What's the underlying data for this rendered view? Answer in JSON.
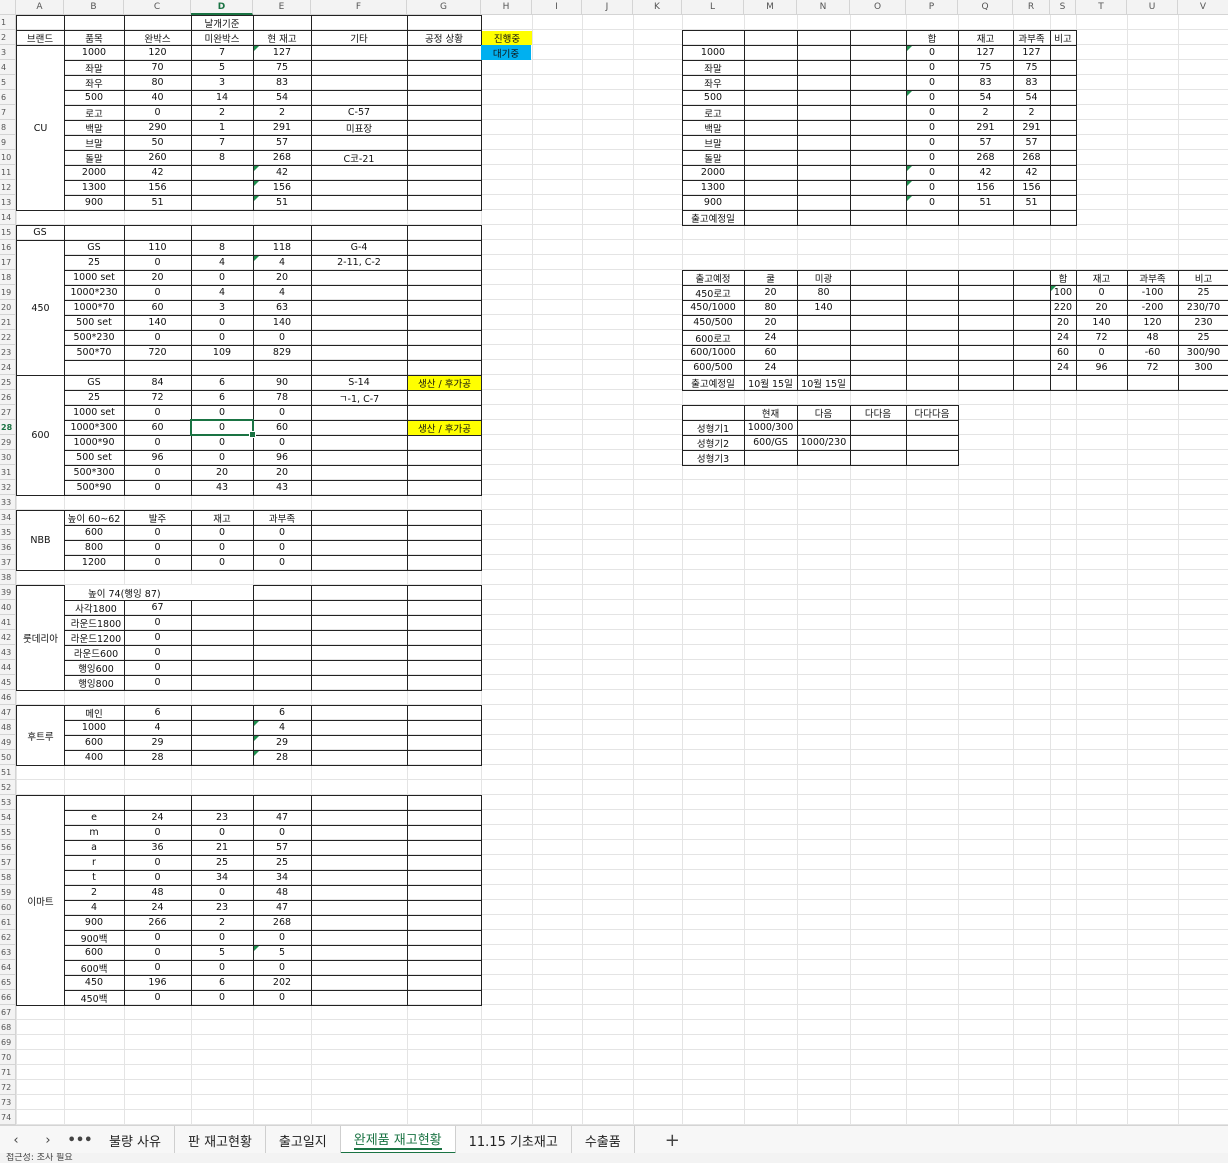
{
  "colors": {
    "yellow": "#ffff00",
    "blue": "#00b0f0",
    "accent": "#1a7343"
  },
  "column_letters": [
    "A",
    "B",
    "C",
    "D",
    "E",
    "F",
    "G",
    "H",
    "I",
    "J",
    "K",
    "L",
    "M",
    "N",
    "O",
    "P",
    "Q",
    "R",
    "S",
    "T",
    "U",
    "V"
  ],
  "selected_column": "D",
  "selected_row": 28,
  "sheet_tabs": [
    "불량 사유",
    "판 재고현황",
    "출고일지",
    "완제품 재고현황",
    "11.15 기초재고",
    "수출품"
  ],
  "active_tab": "완제품 재고현황",
  "status_text": "접근성: 조사 필요",
  "cells": {
    "D1": "날개기준",
    "A2": "브랜드",
    "B2": "품목",
    "C2": "완박스",
    "D2": "미완박스",
    "E2": "현 재고",
    "F2": "기타",
    "G2": "공정 상황",
    "H2": "진행중",
    "H3": "대기중",
    "B3": "1000",
    "C3": "120",
    "D3": "7",
    "E3": "127",
    "B4": "좌말",
    "C4": "70",
    "D4": "5",
    "E4": "75",
    "B5": "좌우",
    "C5": "80",
    "D5": "3",
    "E5": "83",
    "B6": "500",
    "C6": "40",
    "D6": "14",
    "E6": "54",
    "B7": "로고",
    "C7": "0",
    "D7": "2",
    "E7": "2",
    "F7": "C-57",
    "A8": "CU",
    "B8": "백말",
    "C8": "290",
    "D8": "1",
    "E8": "291",
    "F8": "미표장",
    "B9": "브말",
    "C9": "50",
    "D9": "7",
    "E9": "57",
    "B10": "돌말",
    "C10": "260",
    "D10": "8",
    "E10": "268",
    "F10": "C코-21",
    "B11": "2000",
    "C11": "42",
    "E11": "42",
    "B12": "1300",
    "C12": "156",
    "E12": "156",
    "B13": "900",
    "C13": "51",
    "E13": "51",
    "A15": "GS",
    "B16": "GS",
    "C16": "110",
    "D16": "8",
    "E16": "118",
    "F16": "G-4",
    "B17": "25",
    "C17": "0",
    "D17": "4",
    "E17": "4",
    "F17": "2-11, C-2",
    "B18": "1000 set",
    "C18": "20",
    "D18": "0",
    "E18": "20",
    "B19": "1000*230",
    "C19": "0",
    "D19": "4",
    "E19": "4",
    "A20": "450",
    "B20": "1000*70",
    "C20": "60",
    "D20": "3",
    "E20": "63",
    "B21": "500 set",
    "C21": "140",
    "D21": "0",
    "E21": "140",
    "B22": "500*230",
    "C22": "0",
    "D22": "0",
    "E22": "0",
    "B23": "500*70",
    "C23": "720",
    "D23": "109",
    "E23": "829",
    "B25": "GS",
    "C25": "84",
    "D25": "6",
    "E25": "90",
    "F25": "S-14",
    "G25": "생산 / 후가공",
    "B26": "25",
    "C26": "72",
    "D26": "6",
    "E26": "78",
    "F26": "ㄱ-1, C-7",
    "B27": "1000 set",
    "C27": "0",
    "D27": "0",
    "E27": "0",
    "A28": "600",
    "B28": "1000*300",
    "C28": "60",
    "D28": "0",
    "E28": "60",
    "G28": "생산 / 후가공",
    "B29": "1000*90",
    "C29": "0",
    "D29": "0",
    "E29": "0",
    "B30": "500 set",
    "C30": "96",
    "D30": "0",
    "E30": "96",
    "B31": "500*300",
    "C31": "0",
    "D31": "20",
    "E31": "20",
    "B32": "500*90",
    "C32": "0",
    "D32": "43",
    "E32": "43",
    "B34": "높이 60~62",
    "C34": "발주",
    "D34": "재고",
    "E34": "과부족",
    "A35": "NBB",
    "B35": "600",
    "C35": "0",
    "D35": "0",
    "E35": "0",
    "B36": "800",
    "C36": "0",
    "D36": "0",
    "E36": "0",
    "B37": "1200",
    "C37": "0",
    "D37": "0",
    "E37": "0",
    "B39": "높이 74(행잉 87)",
    "B40": "사각1800",
    "C40": "67",
    "B41": "라운드1800",
    "C41": "0",
    "A42": "룻데리아",
    "B42": "라운드1200",
    "C42": "0",
    "B43": "라운드600",
    "C43": "0",
    "B44": "행잉600",
    "C44": "0",
    "B45": "행잉800",
    "C45": "0",
    "B47": "메인",
    "C47": "6",
    "E47": "6",
    "A48": "후트루",
    "B48": "1000",
    "C48": "4",
    "E48": "4",
    "B49": "600",
    "C49": "29",
    "E49": "29",
    "B50": "400",
    "C50": "28",
    "E50": "28",
    "B54": "e",
    "C54": "24",
    "D54": "23",
    "E54": "47",
    "B55": "m",
    "C55": "0",
    "D55": "0",
    "E55": "0",
    "B56": "a",
    "C56": "36",
    "D56": "21",
    "E56": "57",
    "B57": "r",
    "C57": "0",
    "D57": "25",
    "E57": "25",
    "B58": "t",
    "C58": "0",
    "D58": "34",
    "E58": "34",
    "B59": "2",
    "C59": "48",
    "D59": "0",
    "E59": "48",
    "A60": "이마트",
    "B60": "4",
    "C60": "24",
    "D60": "23",
    "E60": "47",
    "B61": "900",
    "C61": "266",
    "D61": "2",
    "E61": "268",
    "B62": "900백",
    "C62": "0",
    "D62": "0",
    "E62": "0",
    "B63": "600",
    "C63": "0",
    "D63": "5",
    "E63": "5",
    "B64": "600백",
    "C64": "0",
    "D64": "0",
    "E64": "0",
    "B65": "450",
    "C65": "196",
    "D65": "6",
    "E65": "202",
    "B66": "450백",
    "C66": "0",
    "D66": "0",
    "E66": "0",
    "P2": "합",
    "Q2": "재고",
    "R2": "과부족",
    "S2": "비고",
    "L3": "1000",
    "P3": "0",
    "Q3": "127",
    "R3": "127",
    "L4": "좌말",
    "P4": "0",
    "Q4": "75",
    "R4": "75",
    "L5": "좌우",
    "P5": "0",
    "Q5": "83",
    "R5": "83",
    "L6": "500",
    "P6": "0",
    "Q6": "54",
    "R6": "54",
    "L7": "로고",
    "P7": "0",
    "Q7": "2",
    "R7": "2",
    "L8": "백말",
    "P8": "0",
    "Q8": "291",
    "R8": "291",
    "L9": "브말",
    "P9": "0",
    "Q9": "57",
    "R9": "57",
    "L10": "돌말",
    "P10": "0",
    "Q10": "268",
    "R10": "268",
    "L11": "2000",
    "P11": "0",
    "Q11": "42",
    "R11": "42",
    "L12": "1300",
    "P12": "0",
    "Q12": "156",
    "R12": "156",
    "L13": "900",
    "P13": "0",
    "Q13": "51",
    "R13": "51",
    "L14": "출고예정일",
    "L18": "출고예정",
    "M18": "쿨",
    "N18": "미광",
    "S18": "합",
    "T18": "재고",
    "U18": "과부족",
    "V18": "비고",
    "L19": "450로고",
    "M19": "20",
    "N19": "80",
    "S19": "100",
    "T19": "0",
    "U19": "-100",
    "V19": "25",
    "L20": "450/1000",
    "M20": "80",
    "N20": "140",
    "S20": "220",
    "T20": "20",
    "U20": "-200",
    "V20": "230/70",
    "L21": "450/500",
    "M21": "20",
    "S21": "20",
    "T21": "140",
    "U21": "120",
    "V21": "230",
    "L22": "600로고",
    "M22": "24",
    "S22": "24",
    "T22": "72",
    "U22": "48",
    "V22": "25",
    "L23": "600/1000",
    "M23": "60",
    "S23": "60",
    "T23": "0",
    "U23": "-60",
    "V23": "300/90",
    "L24": "600/500",
    "M24": "24",
    "S24": "24",
    "T24": "96",
    "U24": "72",
    "V24": "300",
    "L25": "출고예정일",
    "M25": "10월 15일",
    "N25": "10월 15일",
    "M27": "현재",
    "N27": "다음",
    "O27": "다다음",
    "P27": "다다다음",
    "L28": "성형기1",
    "M28": "1000/300",
    "L29": "성형기2",
    "M29": "600/GS",
    "N29": "1000/230",
    "L30": "성형기3"
  }
}
